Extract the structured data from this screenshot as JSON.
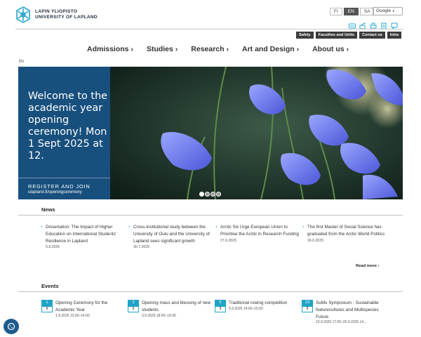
{
  "header": {
    "logo_line1": "LAPIN YLIOPISTO",
    "logo_line2": "UNIVERSITY OF LAPLAND",
    "languages": [
      "FI",
      "EN",
      "SA"
    ],
    "active_language": "EN",
    "translate_label": "Google",
    "translate_caret": "▼",
    "tool_icons": [
      "accessibility-icon",
      "share-icon",
      "print-icon",
      "bookmark-icon",
      "chat-icon"
    ],
    "top_links": [
      "Safety",
      "Faculties and Units",
      "Contact us",
      "Intra"
    ]
  },
  "nav": {
    "items": [
      "Admissions ›",
      "Studies ›",
      "Research ›",
      "Art and Design ›",
      "About us ›"
    ]
  },
  "lang_tag": "EN",
  "hero": {
    "title": "Welcome to the academic year opening ceremony! Mon 1 Sept 2025 at 12.",
    "cta": "REGISTER AND JOIN",
    "url": "ulapland.fi/openingceremony",
    "slide_count": 4,
    "active_slide": 1
  },
  "news": {
    "title": "News",
    "items": [
      {
        "title": "Dissertation: The Impact of Higher Education on International Students' Resilience in Lapland",
        "date": "5.8.2025"
      },
      {
        "title": "Cross-institutional study between the University of Oulu and the University of Lapland sees significant growth",
        "date": "30.7.2025"
      },
      {
        "title": "Arctic Six Urge European Union to Prioritise the Arctic in Research Funding",
        "date": "27.6.2025"
      },
      {
        "title": "The first Master of Social Science has graduated from the Arctic World Politics",
        "date": "16.6.2025"
      }
    ],
    "read_more": "Read more ›"
  },
  "events": {
    "title": "Events",
    "items": [
      {
        "day": "1",
        "month": "9",
        "title": "Opening Ceremony for the Academic Year",
        "time": "1.9.2025 12:00–14:00"
      },
      {
        "day": "3",
        "month": "9",
        "title": "Opening mass and blessing of new students",
        "time": "3.9.2025 18:00–19:30"
      },
      {
        "day": "5",
        "month": "9",
        "title": "Traditional rowing competition",
        "time": "5.9.2025 14:00–15:00"
      },
      {
        "day": "23",
        "month": "9",
        "title": "SuMu Symposium - Sustainable Naturecultures and Multispecies Future",
        "time": "23.9.2025 17:00–25.9.2025 14..."
      }
    ]
  },
  "colors": {
    "hero_panel": "#174f7d",
    "accent": "#20a3c7",
    "link_chevron": "#1a88b8"
  }
}
